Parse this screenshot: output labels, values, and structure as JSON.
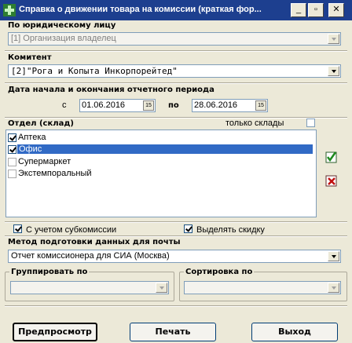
{
  "window": {
    "title": "Справка о движении товара на комиссии (краткая фор...",
    "minimize_glyph": "_",
    "restore_glyph": "▫",
    "close_glyph": "✕"
  },
  "legal_entity": {
    "label": "По юридическому лицу",
    "value": "[1] Организация владелец"
  },
  "consignor": {
    "label": "Комитент",
    "value": "[2]\"Рога и Копыта Инкорпорейтед\""
  },
  "period": {
    "label": "Дата начала и окончания отчетного периода",
    "from_label": "с",
    "from_value": "01.06.2016",
    "to_label": "по",
    "to_value": "28.06.2016",
    "cal_glyph": "15"
  },
  "departments": {
    "label": "Отдел (склад)",
    "only_warehouses_label": "только склады",
    "only_warehouses_checked": false,
    "items": [
      {
        "label": "Аптека",
        "checked": true,
        "selected": false
      },
      {
        "label": "Офис",
        "checked": true,
        "selected": true
      },
      {
        "label": "Супермаркет",
        "checked": false,
        "selected": false
      },
      {
        "label": "Экстемпоральный",
        "checked": false,
        "selected": false
      }
    ]
  },
  "options": {
    "subcommission_label": "С учетом субкомиссии",
    "subcommission_checked": true,
    "highlight_discount_label": "Выделять скидку",
    "highlight_discount_checked": true
  },
  "mail_method": {
    "label": "Метод подготовки данных для почты",
    "value": "Отчет комиссионера для СИА (Москва)"
  },
  "group_by": {
    "label": "Группировать по",
    "value": ""
  },
  "sort_by": {
    "label": "Сортировка по",
    "value": ""
  },
  "buttons": {
    "preview": "Предпросмотр",
    "print": "Печать",
    "exit": "Выход"
  }
}
